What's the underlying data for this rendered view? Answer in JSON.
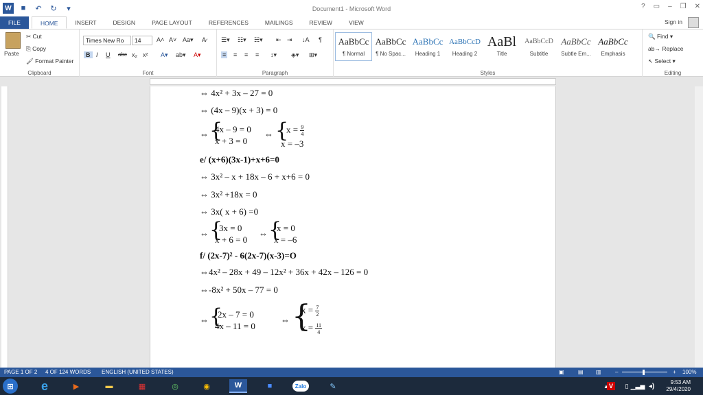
{
  "app": {
    "title": "Document1 - Microsoft Word",
    "sign_in": "Sign in"
  },
  "tabs": [
    "FILE",
    "HOME",
    "INSERT",
    "DESIGN",
    "PAGE LAYOUT",
    "REFERENCES",
    "MAILINGS",
    "REVIEW",
    "VIEW"
  ],
  "clipboard": {
    "paste": "Paste",
    "cut": "Cut",
    "copy": "Copy",
    "format_painter": "Format Painter",
    "label": "Clipboard"
  },
  "font": {
    "name": "Times New Ro",
    "size": "14",
    "label": "Font"
  },
  "paragraph": {
    "label": "Paragraph"
  },
  "styles": {
    "items": [
      {
        "preview": "AaBbCc",
        "name": "¶ Normal"
      },
      {
        "preview": "AaBbCc",
        "name": "¶ No Spac..."
      },
      {
        "preview": "AaBbCc",
        "name": "Heading 1"
      },
      {
        "preview": "AaBbCcD",
        "name": "Heading 2"
      },
      {
        "preview": "AaBl",
        "name": "Title"
      },
      {
        "preview": "AaBbCcD",
        "name": "Subtitle"
      },
      {
        "preview": "AaBbCc",
        "name": "Subtle Em..."
      },
      {
        "preview": "AaBbCc",
        "name": "Emphasis"
      }
    ],
    "label": "Styles"
  },
  "editing": {
    "find": "Find",
    "replace": "Replace",
    "select": "Select",
    "label": "Editing"
  },
  "doc": {
    "l1": "⇔ 4x² + 3x – 27 = 0",
    "l2": "⇔ (4x – 9)(x + 3) = 0",
    "s1a": "4x – 9 = 0",
    "s1b": "x + 3 = 0",
    "s1c": "x =",
    "s1cn": "9",
    "s1cd": "4",
    "s1d": "x = –3",
    "h_e": "e/ (x+6)(3x-1)+x+6=0",
    "l3": "⇔ 3x² – x + 18x – 6 + x+6 = 0",
    "l4": "⇔ 3x² +18x = 0",
    "l5": "⇔ 3x( x + 6) =0",
    "s2a": "3x = 0",
    "s2b": "x + 6 = 0",
    "s2c": "x = 0",
    "s2d": "x = –6",
    "h_f": "f/ (2x-7)² - 6(2x-7)(x-3)=O",
    "l6": "⇔4x² – 28x + 49 – 12x² + 36x + 42x – 126 = 0",
    "l7": "⇔-8x² + 50x – 77 = 0",
    "s3a": "2x – 7 = 0",
    "s3b": "4x – 11 = 0",
    "s3cn": "7",
    "s3cd": "2",
    "s3dn": "11",
    "s3dd": "4",
    "xeq": "x =",
    "arrow": "⇔"
  },
  "status": {
    "page": "PAGE 1 OF 2",
    "words": "4 OF 124 WORDS",
    "lang": "ENGLISH (UNITED STATES)",
    "zoom": "100%"
  },
  "clock": {
    "time": "9:53 AM",
    "date": "29/4/2020"
  },
  "taskbar": {
    "zalo": "Zalo"
  }
}
